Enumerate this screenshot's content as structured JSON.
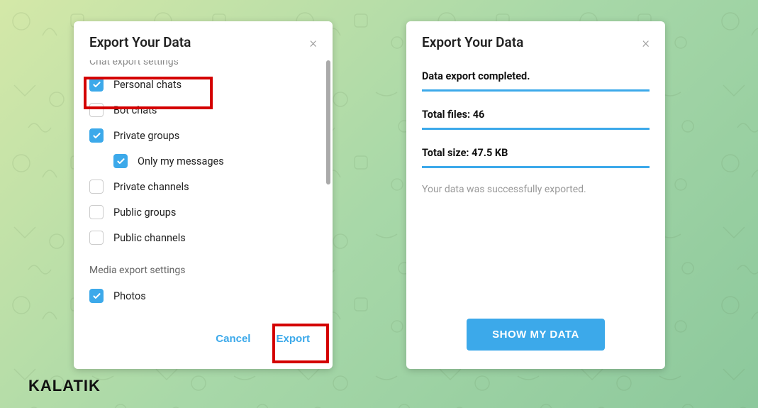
{
  "left": {
    "title": "Export Your Data",
    "section1": "Chat export settings",
    "items": {
      "personal": "Personal chats",
      "bot": "Bot chats",
      "privgroups": "Private groups",
      "onlymy": "Only my messages",
      "privchan": "Private channels",
      "pubgroups": "Public groups",
      "pubchan": "Public channels"
    },
    "section2": "Media export settings",
    "photos": "Photos",
    "cancel": "Cancel",
    "export": "Export"
  },
  "right": {
    "title": "Export Your Data",
    "completed": "Data export completed.",
    "files": "Total files: 46",
    "size": "Total size: 47.5 KB",
    "msg": "Your data was successfully exported.",
    "show": "SHOW MY DATA"
  },
  "watermark": "KALATIK"
}
